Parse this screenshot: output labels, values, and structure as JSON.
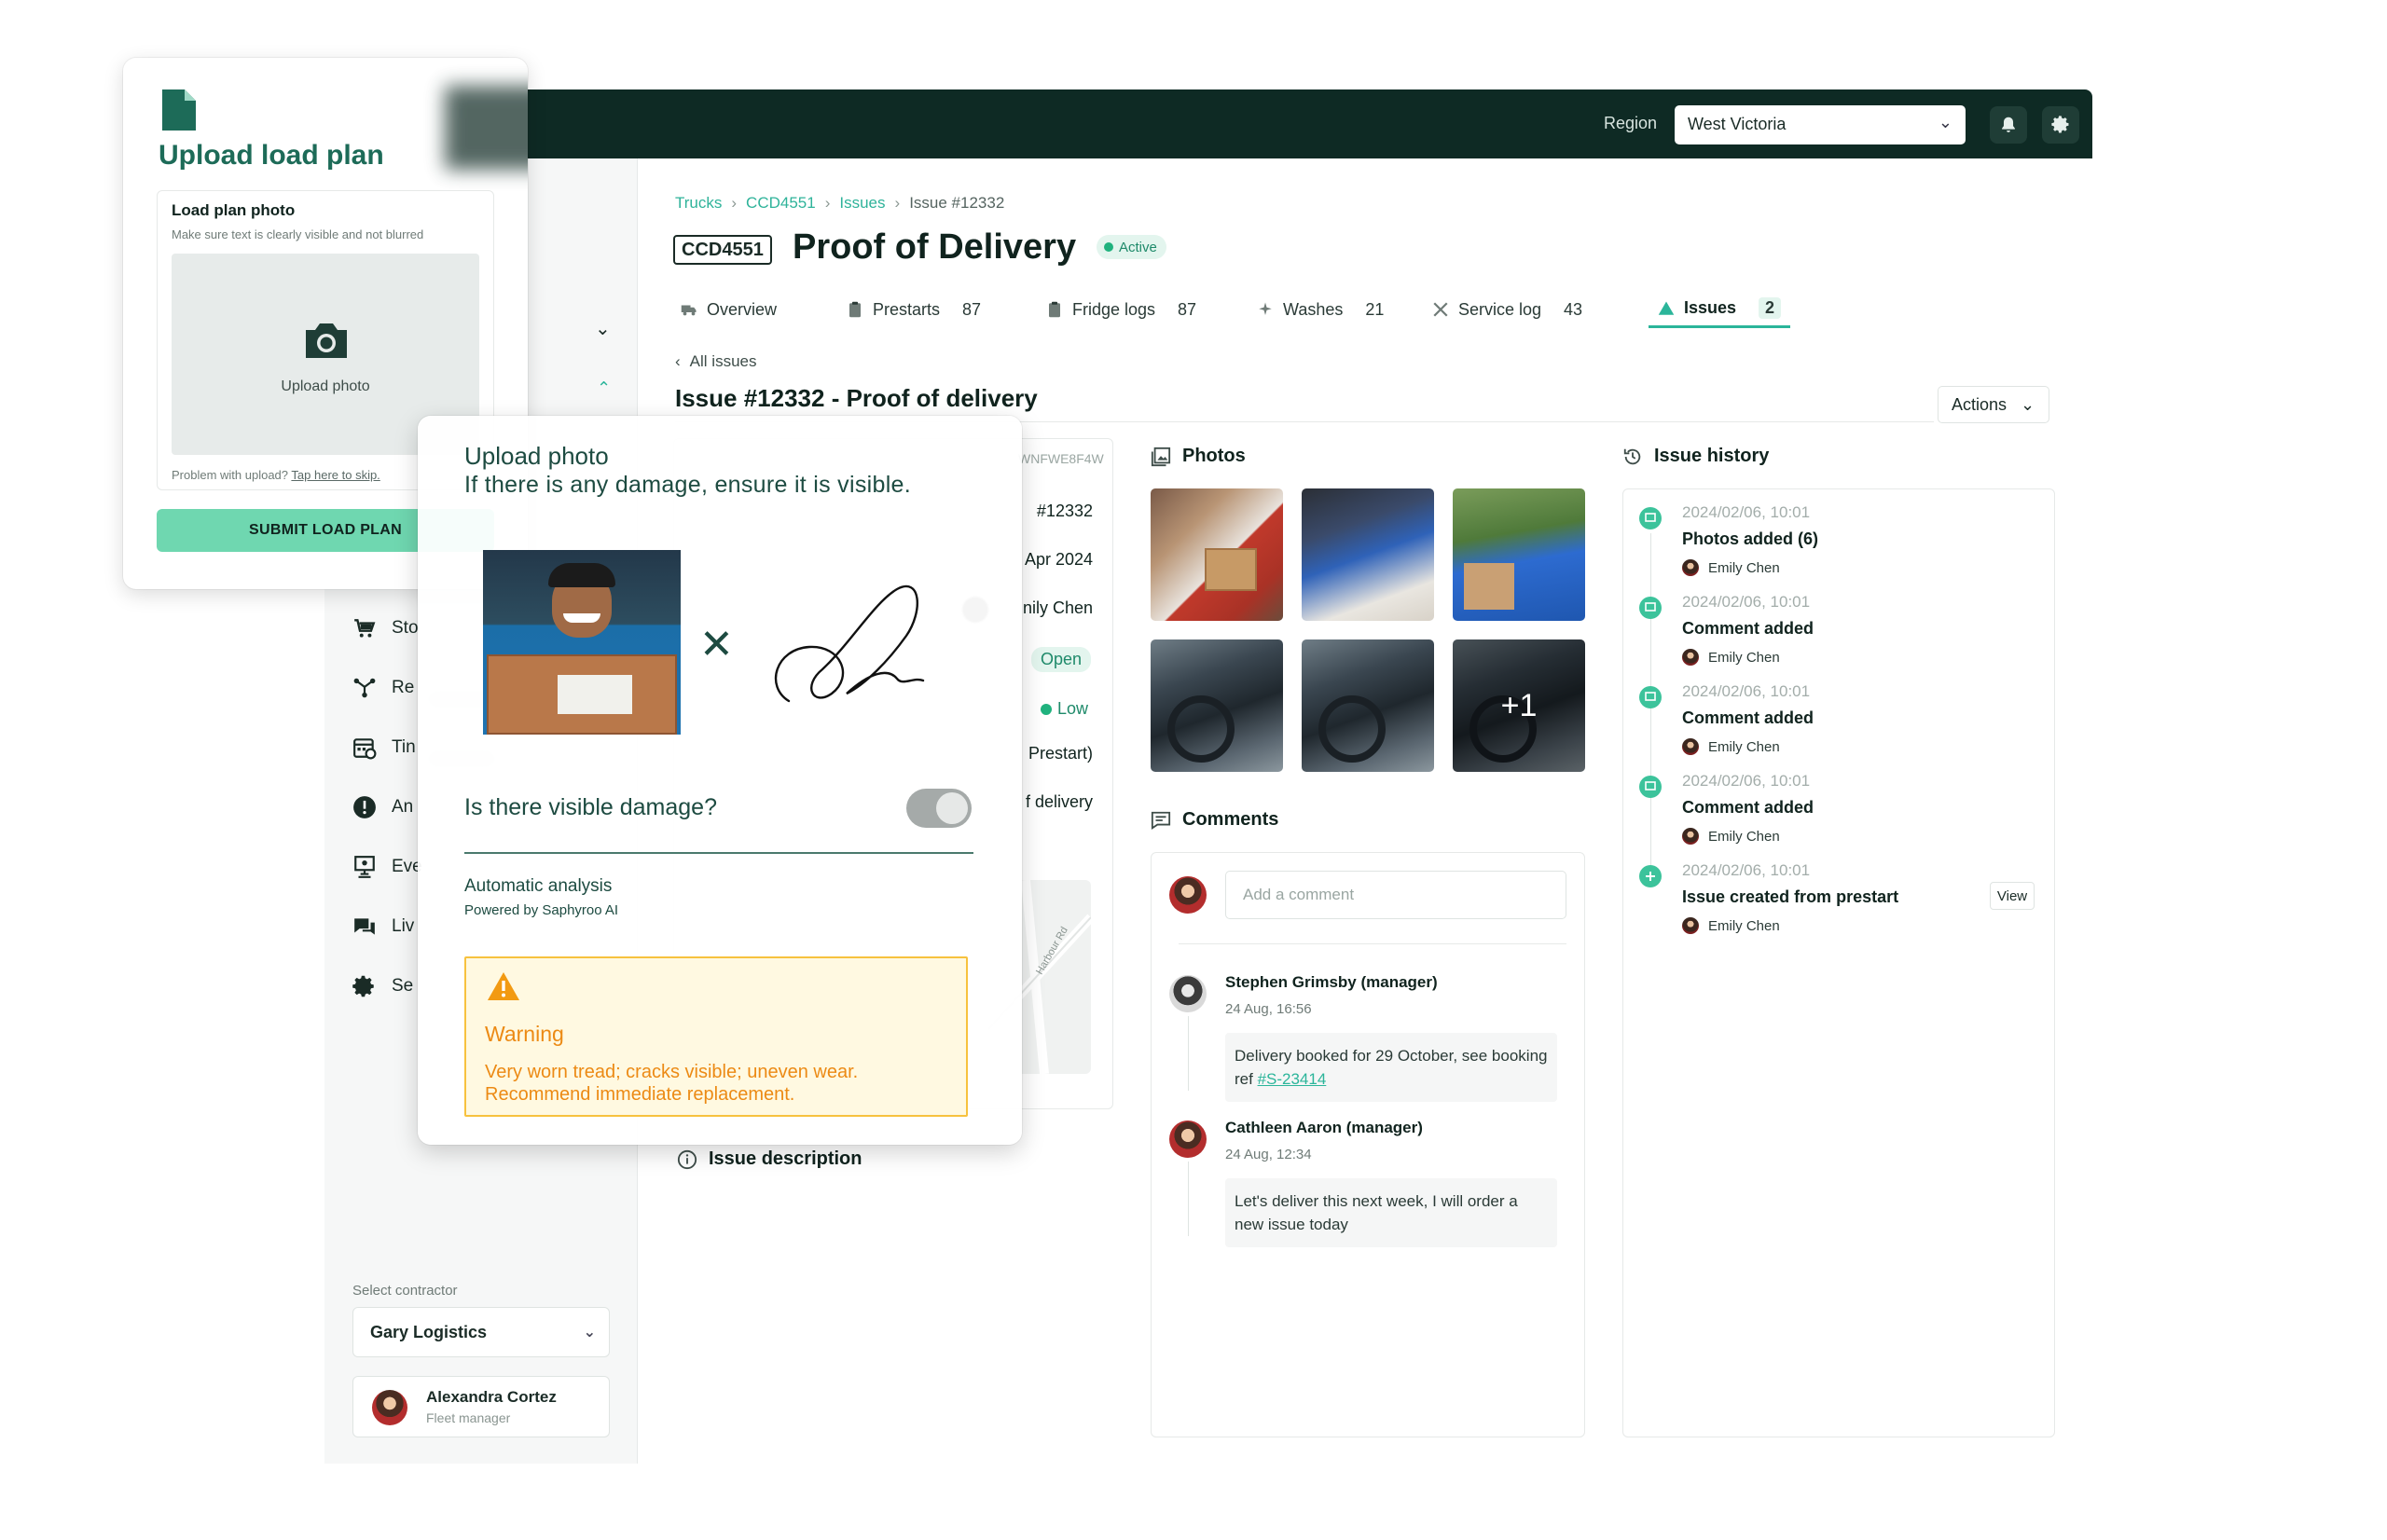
{
  "topbar": {
    "region_label": "Region",
    "region_value": "West Victoria"
  },
  "sidebar": {
    "items": [
      {
        "label": "Sto",
        "icon": "cart-icon"
      },
      {
        "label": "Re",
        "icon": "routes-icon"
      },
      {
        "label": "Tin",
        "icon": "calendar-icon"
      },
      {
        "label": "An",
        "icon": "alert-icon"
      },
      {
        "label": "Eve",
        "icon": "presentation-icon"
      },
      {
        "label": "Liv",
        "icon": "chat-icon"
      },
      {
        "label": "Se",
        "icon": "gear-icon"
      }
    ],
    "contractor_label": "Select contractor",
    "contractor_value": "Gary Logistics",
    "user": {
      "name": "Alexandra Cortez",
      "role": "Fleet manager"
    }
  },
  "breadcrumb": {
    "items": [
      "Trucks",
      "CCD4551",
      "Issues"
    ],
    "current": "Issue #12332"
  },
  "header": {
    "truck_id": "CCD4551",
    "title": "Proof of Delivery",
    "status": "Active"
  },
  "tabs": [
    {
      "label": "Overview",
      "count": ""
    },
    {
      "label": "Prestarts",
      "count": "87"
    },
    {
      "label": "Fridge logs",
      "count": "87"
    },
    {
      "label": "Washes",
      "count": "21"
    },
    {
      "label": "Service log",
      "count": "43"
    },
    {
      "label": "Issues",
      "count": "2"
    }
  ],
  "issue": {
    "back_label": "All issues",
    "title": "Issue #12332 - Proof of delivery",
    "actions_label": "Actions",
    "vin_fragment": "WNFWE8F4W",
    "details": {
      "number": "#12332",
      "date": "Apr 2024",
      "reporter": "nily Chen",
      "status": "Open",
      "priority": "Low",
      "source": "Prestart)",
      "type": "f delivery"
    },
    "map_street": "Harbour Rd",
    "description_label": "Issue description"
  },
  "photos": {
    "heading": "Photos",
    "more_label": "+1"
  },
  "comments": {
    "heading": "Comments",
    "placeholder": "Add a comment",
    "items": [
      {
        "author": "Stephen Grimsby (manager)",
        "time": "24 Aug, 16:56",
        "text_before": "Delivery booked for 29 October, see booking ref ",
        "link": "#S-23414"
      },
      {
        "author": "Cathleen Aaron (manager)",
        "time": "24 Aug, 12:34",
        "text_before": "Let's deliver this next week, I will order a new issue today",
        "link": ""
      }
    ]
  },
  "history": {
    "heading": "Issue history",
    "view_label": "View",
    "items": [
      {
        "date": "2024/02/06, 10:01",
        "title": "Photos added (6)",
        "user": "Emily Chen"
      },
      {
        "date": "2024/02/06, 10:01",
        "title": "Comment added",
        "user": "Emily Chen"
      },
      {
        "date": "2024/02/06, 10:01",
        "title": "Comment added",
        "user": "Emily Chen"
      },
      {
        "date": "2024/02/06, 10:01",
        "title": "Comment added",
        "user": "Emily Chen"
      },
      {
        "date": "2024/02/06, 10:01",
        "title": "Issue created from prestart",
        "user": "Emily Chen"
      }
    ]
  },
  "load_plan": {
    "title": "Upload load plan",
    "photo_heading": "Load plan photo",
    "photo_hint": "Make sure text is clearly visible and not blurred",
    "upload_label": "Upload photo",
    "skip_prefix": "Problem with upload? ",
    "skip_link": "Tap here to skip.",
    "submit_label": "SUBMIT LOAD PLAN"
  },
  "upload_photo": {
    "title": "Upload photo",
    "subtitle": "If there is any damage, ensure it is visible.",
    "question": "Is there visible damage?",
    "toggle_on": false,
    "analysis_title": "Automatic analysis",
    "analysis_powered": "Powered by Saphyroo AI",
    "warning_title": "Warning",
    "warning_body": "Very worn tread; cracks visible; uneven wear. Recommend immediate replacement."
  },
  "colors": {
    "topbar": "#0e2a24",
    "accent": "#2bb59a",
    "submit": "#6fd7b0",
    "warning": "#ec8a14",
    "warning_bg": "#fff9e1"
  }
}
